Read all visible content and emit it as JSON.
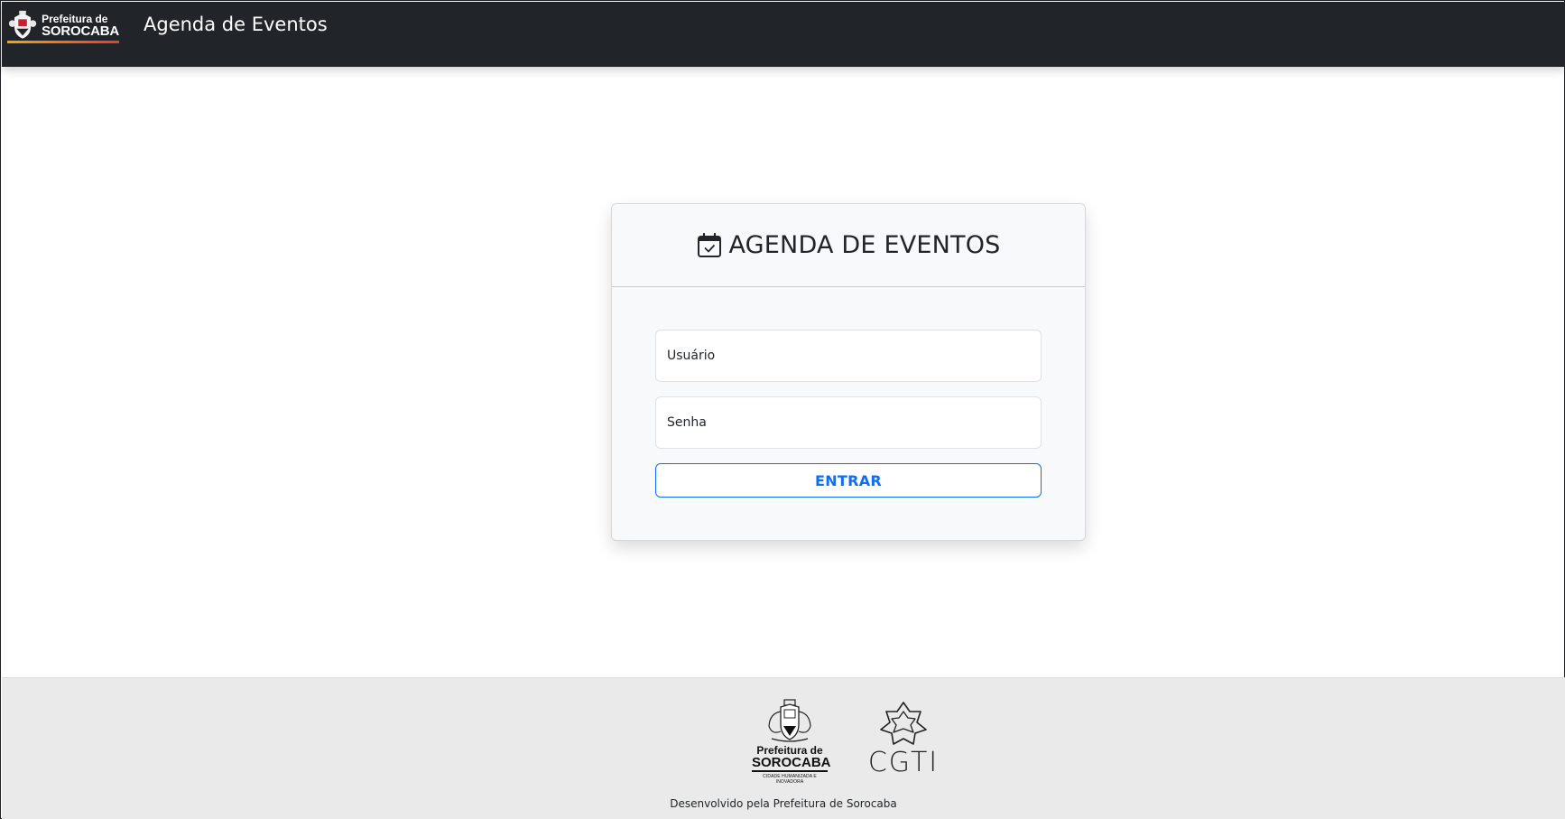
{
  "navbar": {
    "brand": {
      "line1": "Prefeitura de",
      "line2": "SOROCABA"
    },
    "title": "Agenda de Eventos"
  },
  "login": {
    "heading": "AGENDA DE EVENTOS",
    "heading_icon": "calendar-check-icon",
    "username_placeholder": "Usuário",
    "password_placeholder": "Senha",
    "submit_label": "ENTRAR"
  },
  "footer": {
    "logo_prefeitura": {
      "line1": "Prefeitura de",
      "line2": "SOROCABA",
      "tagline": "CIDADE HUMANIZADA E INOVADORA"
    },
    "logo_cgti": {
      "text": "CGTI"
    },
    "credit": "Desenvolvido pela Prefeitura de Sorocaba"
  },
  "colors": {
    "navbar_bg": "#212529",
    "primary": "#0d6efd",
    "footer_bg": "#eaeaea",
    "card_bg": "#f8f9fa"
  }
}
